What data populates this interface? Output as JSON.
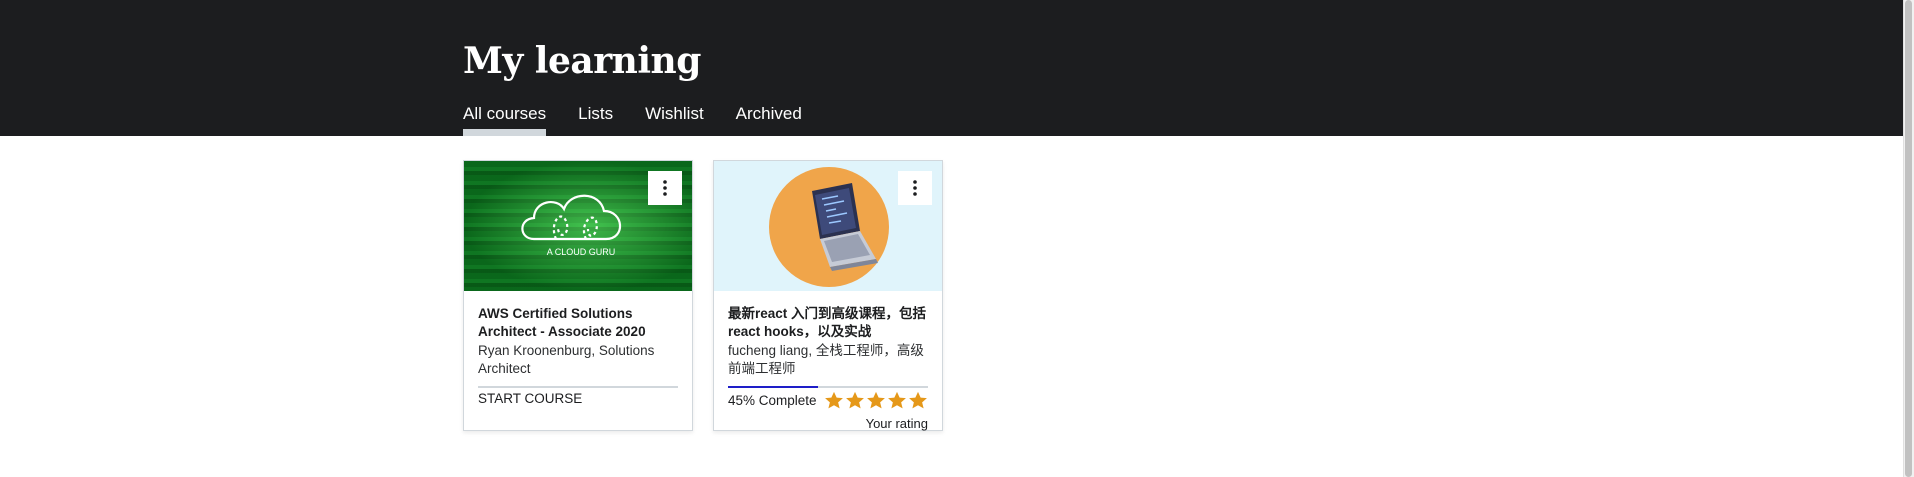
{
  "page": {
    "title": "My learning"
  },
  "tabs": [
    {
      "label": "All courses",
      "active": true
    },
    {
      "label": "Lists"
    },
    {
      "label": "Wishlist"
    },
    {
      "label": "Archived"
    }
  ],
  "courses": [
    {
      "thumbnail_text": "A CLOUD GURU",
      "title": "AWS Certified Solutions Architect - Associate 2020",
      "instructor": "Ryan Kroonenburg, Solutions Architect",
      "progress_percent": 0,
      "action_label": "START COURSE"
    },
    {
      "title": "最新react 入门到高级课程，包括react hooks，以及实战",
      "instructor": "fucheng liang, 全栈工程师，高级前端工程师",
      "progress_percent": 45,
      "progress_label": "45% Complete",
      "rating_stars": 5,
      "rating_label": "Your rating"
    }
  ],
  "colors": {
    "header_bg": "#1c1d1f",
    "progress_fill": "#1e1ec8",
    "star": "#e59819"
  },
  "icons": {
    "more": "more-vertical-icon",
    "star": "star-icon"
  }
}
